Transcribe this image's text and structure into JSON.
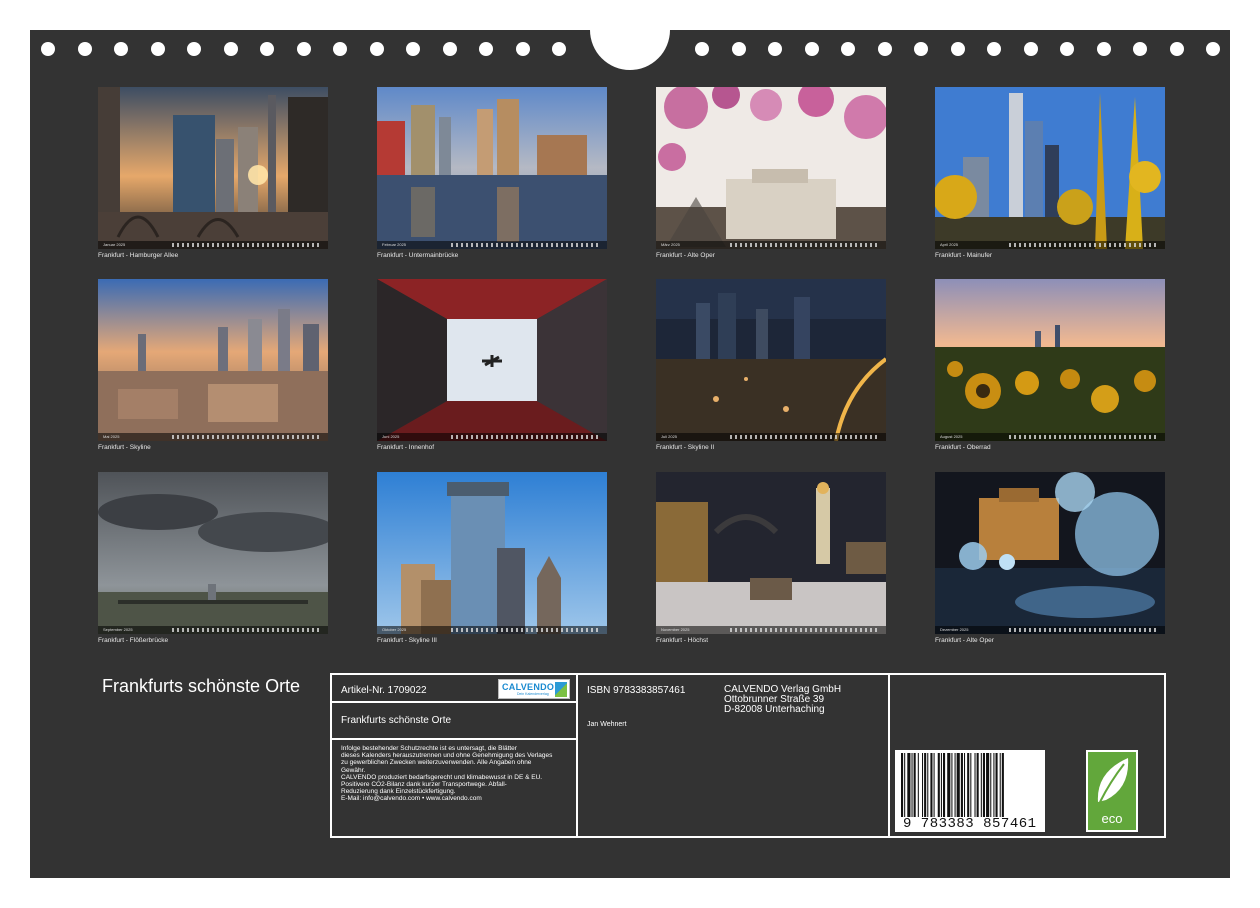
{
  "photos": [
    {
      "caption": "Frankfurt - Hamburger Allee",
      "month": "Januar 2025"
    },
    {
      "caption": "Frankfurt - Untermainbrücke",
      "month": "Februar 2025"
    },
    {
      "caption": "Frankfurt - Alte Oper",
      "month": "März 2025"
    },
    {
      "caption": "Frankfurt - Mainufer",
      "month": "April 2025"
    },
    {
      "caption": "Frankfurt - Skyline",
      "month": "Mai 2025"
    },
    {
      "caption": "Frankfurt - Innenhof",
      "month": "Juni 2025"
    },
    {
      "caption": "Frankfurt - Skyline II",
      "month": "Juli 2025"
    },
    {
      "caption": "Frankfurt - Oberrad",
      "month": "August 2025"
    },
    {
      "caption": "Frankfurt - Flößerbrücke",
      "month": "September 2025"
    },
    {
      "caption": "Frankfurt - Skyline III",
      "month": "Oktober 2025"
    },
    {
      "caption": "Frankfurt - Höchst",
      "month": "November 2025"
    },
    {
      "caption": "Frankfurt - Alte Oper",
      "month": "Dezember 2025"
    }
  ],
  "title": "Frankfurts schönste Orte",
  "info": {
    "article": "Artikel-Nr. 1709022",
    "logo": "CALVENDO",
    "logo_sub": "Dein Kalenderverlag",
    "product_title": "Frankfurts schönste Orte",
    "legal": [
      "Infolge bestehender Schutzrechte ist es untersagt, die Blätter",
      "dieses Kalenders herauszutrennen und ohne Genehmigung des Verlages",
      "zu gewerblichen Zwecken weiterzuverwenden. Alle Angaben ohne",
      "Gewähr.",
      "CALVENDO produziert bedarfsgerecht und klimabewusst in DE & EU.",
      "Positivere CO2-Bilanz dank kurzer Transportwege. Abfall-",
      "Reduzierung dank Einzelstückfertigung.",
      "E-Mail: info@calvendo.com • www.calvendo.com"
    ],
    "isbn": "ISBN 9783383857461",
    "author": "Jan Wehnert",
    "publisher": [
      "CALVENDO Verlag GmbH",
      "Ottobrunner Straße 39",
      "D-82008 Unterhaching"
    ],
    "barcode_number": "9 783383 857461",
    "eco_label": "eco"
  },
  "colors": {
    "background": "#333333",
    "frame": "#ffffff",
    "eco": "#62a73b",
    "calvendo": "#1a8ad0"
  }
}
